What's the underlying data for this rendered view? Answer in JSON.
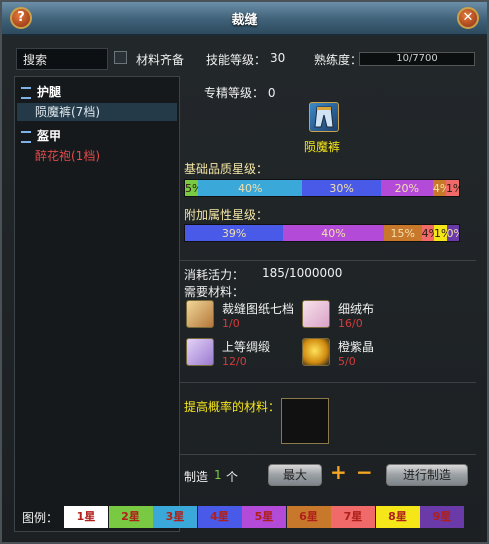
{
  "window": {
    "title": "裁缝"
  },
  "topbar": {
    "search_value": "搜索",
    "materials_checkbox_label": "材料齐备",
    "skill_level_label": "技能等级：",
    "skill_level_value": "30",
    "proficiency_label": "熟练度：",
    "proficiency_value": "10/7700"
  },
  "sidebar": {
    "categories": [
      {
        "label": "护腿",
        "items": [
          {
            "label": "陨魔裤(7档)"
          }
        ]
      },
      {
        "label": "盔甲",
        "items": [
          {
            "label": "醉花袍(1档)"
          }
        ]
      }
    ]
  },
  "detail": {
    "specialization": "专精等级：  0",
    "item_name": "陨魔裤",
    "base_quality_label": "基础品质星级：",
    "base_quality": [
      {
        "label": "5%",
        "pct": 5,
        "color": "#7ac943"
      },
      {
        "label": "40%",
        "pct": 40,
        "color": "#3aa8d8"
      },
      {
        "label": "30%",
        "pct": 30,
        "color": "#4a5ae8"
      },
      {
        "label": "20%",
        "pct": 20,
        "color": "#b44ad8"
      },
      {
        "label": "4%",
        "pct": 4,
        "color": "#c8782a"
      },
      {
        "label": "1%",
        "pct": 1,
        "color": "#f06a6a"
      }
    ],
    "extra_quality_label": "附加属性星级：",
    "extra_quality": [
      {
        "label": "39%",
        "pct": 39,
        "color": "#4a5ae8"
      },
      {
        "label": "40%",
        "pct": 40,
        "color": "#b44ad8"
      },
      {
        "label": "15%",
        "pct": 15,
        "color": "#c8782a"
      },
      {
        "label": "4%",
        "pct": 4,
        "color": "#f06a6a"
      },
      {
        "label": "1%",
        "pct": 1,
        "color": "#f5e61a"
      },
      {
        "label": "0%",
        "pct": 0,
        "color": "#6a3aa8"
      }
    ],
    "energy_label": "消耗活力：",
    "energy_value": "185/1000000",
    "materials_label": "需要材料：",
    "materials": [
      {
        "name": "裁缝图纸七档",
        "count": "1/0",
        "icon": "blueprint-icon"
      },
      {
        "name": "细绒布",
        "count": "16/0",
        "icon": "cloth-roll-icon"
      },
      {
        "name": "上等绸缎",
        "count": "12/0",
        "icon": "silk-icon"
      },
      {
        "name": "橙紫晶",
        "count": "5/0",
        "icon": "crystal-icon"
      }
    ],
    "improve_label": "提高概率的材料："
  },
  "make": {
    "label": "制造",
    "count": "1",
    "unit": "个",
    "max_button": "最大",
    "plus": "+",
    "minus": "−",
    "craft_button": "进行制造"
  },
  "legend": {
    "label": "图例：",
    "items": [
      {
        "label": "1星",
        "color": "#ffffff"
      },
      {
        "label": "2星",
        "color": "#7ac943"
      },
      {
        "label": "3星",
        "color": "#3aa8d8"
      },
      {
        "label": "4星",
        "color": "#4a5ae8"
      },
      {
        "label": "5星",
        "color": "#b44ad8"
      },
      {
        "label": "6星",
        "color": "#c8782a"
      },
      {
        "label": "7星",
        "color": "#f06a6a"
      },
      {
        "label": "8星",
        "color": "#f5e61a"
      },
      {
        "label": "9星",
        "color": "#6a3aa8"
      }
    ]
  }
}
